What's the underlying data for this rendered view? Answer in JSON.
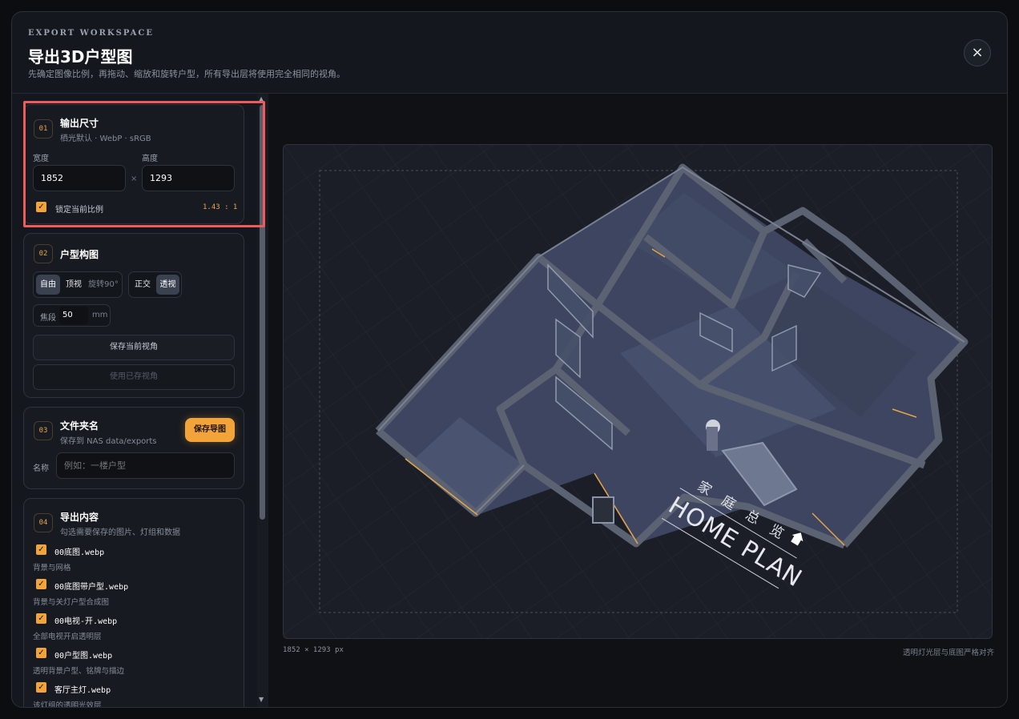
{
  "header": {
    "eyebrow": "EXPORT WORKSPACE",
    "title": "导出3D户型图",
    "subtitle": "先确定图像比例，再拖动、缩放和旋转户型，所有导出层将使用完全相同的视角。",
    "close_symbol": "×"
  },
  "size_card": {
    "step": "01",
    "title": "输出尺寸",
    "sub": "栖光默认 · WebP · sRGB",
    "width_label": "宽度",
    "height_label": "高度",
    "width": "1852",
    "height": "1293",
    "times": "×",
    "lock_label": "锁定当前比例",
    "lock_checked": true,
    "ratio": "1.43 : 1"
  },
  "composition_card": {
    "step": "02",
    "title": "户型构图",
    "view_modes": [
      "自由",
      "顶视",
      "旋转90°"
    ],
    "active_view": "自由",
    "projections": [
      "正交",
      "透视"
    ],
    "active_projection": "透视",
    "focal_label": "焦段",
    "focal_value": "50",
    "focal_unit": "mm",
    "save_view": "保存当前视角",
    "use_view": "使用已存视角"
  },
  "folder_card": {
    "step": "03",
    "title": "文件夹名",
    "sub": "保存到 NAS data/exports",
    "save_button": "保存导图",
    "name_label": "名称",
    "name_placeholder": "例如：一楼户型"
  },
  "content_card": {
    "step": "04",
    "title": "导出内容",
    "sub": "勾选需要保存的图片、灯组和数据",
    "items": [
      {
        "name": "00底图.webp",
        "desc": "背景与网格",
        "checked": true
      },
      {
        "name": "00底图带户型.webp",
        "desc": "背景与关灯户型合成图",
        "checked": true
      },
      {
        "name": "00电视-开.webp",
        "desc": "全部电视开启透明层",
        "checked": true
      },
      {
        "name": "00户型图.webp",
        "desc": "透明背景户型、铭牌与描边",
        "checked": true
      },
      {
        "name": "客厅主灯.webp",
        "desc": "该灯组的透明光效层",
        "checked": true
      }
    ]
  },
  "preview": {
    "floor_label_cn": [
      "家",
      "庭",
      "总",
      "览"
    ],
    "floor_label_en": "HOME PLAN",
    "dims": "1852 × 1293 px",
    "align_note": "透明灯光层与底图严格对齐"
  },
  "colors": {
    "accent": "#f2a43a",
    "highlight": "#f05a5a",
    "background": "#14171d"
  }
}
